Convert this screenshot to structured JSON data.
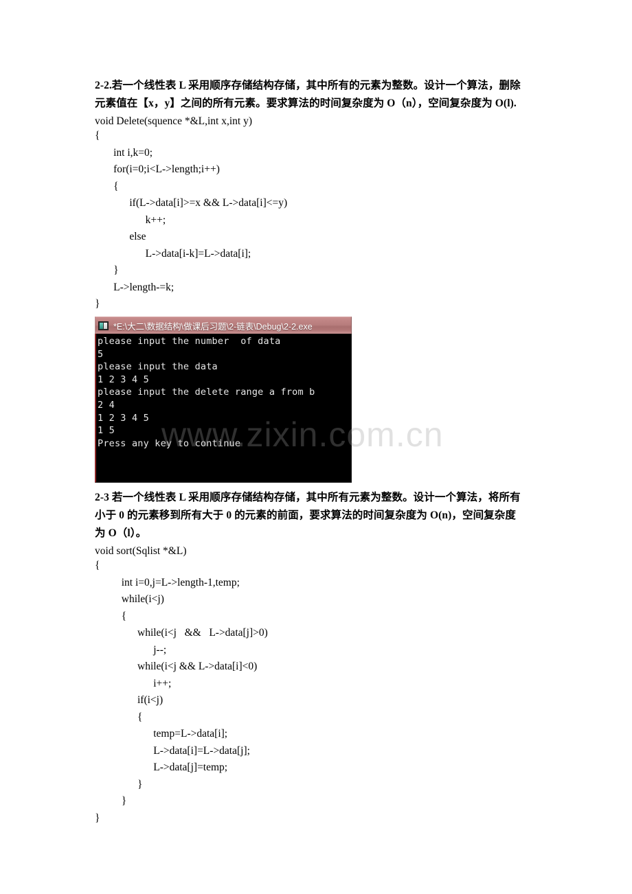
{
  "document": {
    "watermark": "www.zixin.com.cn"
  },
  "problem_2_2": {
    "heading_line1": "2-2.若一个线性表 L 采用顺序存储结构存储，其中所有的元素为整数。设计一个算法，删除",
    "heading_line2": "元素值在【x，y】之间的所有元素。要求算法的时间复杂度为 O（n），空间复杂度为 O(l).",
    "signature": "void Delete(squence *&L,int x,int y)",
    "code": [
      "{",
      "       int i,k=0;",
      "       for(i=0;i<L->length;i++)",
      "       {",
      "             if(L->data[i]>=x && L->data[i]<=y)",
      "                   k++;",
      "             else",
      "                   L->data[i-k]=L->data[i];",
      "       }",
      "       L->length-=k;",
      "}"
    ]
  },
  "console_window": {
    "title": "*E:\\大二\\数据结构\\做课后习题\\2-链表\\Debug\\2-2.exe",
    "icon": "console-window-icon",
    "lines": [
      "please input the number  of data",
      "5",
      "please input the data",
      "1 2 3 4 5",
      "please input the delete range a from b",
      "2 4",
      "1 2 3 4 5",
      "1 5",
      "Press any key to continue"
    ]
  },
  "problem_2_3": {
    "heading_line1": "2-3 若一个线性表 L 采用顺序存储结构存储，其中所有元素为整数。设计一个算法，将所有",
    "heading_line2": "小于 0 的元素移到所有大于 0 的元素的前面，要求算法的时间复杂度为 O(n)，空间复杂度",
    "heading_line3": "为 O（l）。",
    "signature": "void sort(Sqlist *&L)",
    "code": [
      "{",
      "          int i=0,j=L->length-1,temp;",
      "          while(i<j)",
      "          {",
      "                while(i<j   &&   L->data[j]>0)",
      "                      j--;",
      "                while(i<j && L->data[i]<0)",
      "                      i++;",
      "                if(i<j)",
      "                {",
      "                      temp=L->data[i];",
      "                      L->data[i]=L->data[j];",
      "                      L->data[j]=temp;",
      "                }",
      "          }",
      "}"
    ]
  }
}
